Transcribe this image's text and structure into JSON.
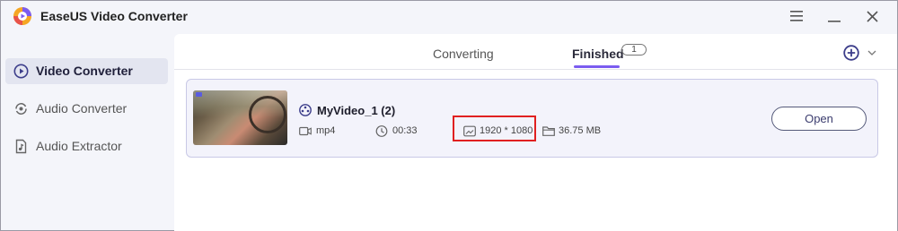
{
  "app": {
    "title": "EaseUS Video Converter"
  },
  "window_controls": {
    "menu_icon": "hamburger-icon",
    "minimize_icon": "minimize-icon",
    "close_icon": "close-icon"
  },
  "sidebar": {
    "items": [
      {
        "label": "Video Converter",
        "icon": "video-converter-icon",
        "active": true
      },
      {
        "label": "Audio Converter",
        "icon": "audio-converter-icon",
        "active": false
      },
      {
        "label": "Audio Extractor",
        "icon": "audio-extractor-icon",
        "active": false
      }
    ]
  },
  "tabs": {
    "converting_label": "Converting",
    "finished_label": "Finished",
    "finished_count": "1"
  },
  "file": {
    "name": "MyVideo_1 (2)",
    "format": "mp4",
    "duration": "00:33",
    "resolution": "1920 * 1080",
    "size": "36.75 MB",
    "open_label": "Open"
  },
  "colors": {
    "accent": "#7b5cf0",
    "highlight": "#e02020",
    "card_border": "#c9c9e6"
  }
}
